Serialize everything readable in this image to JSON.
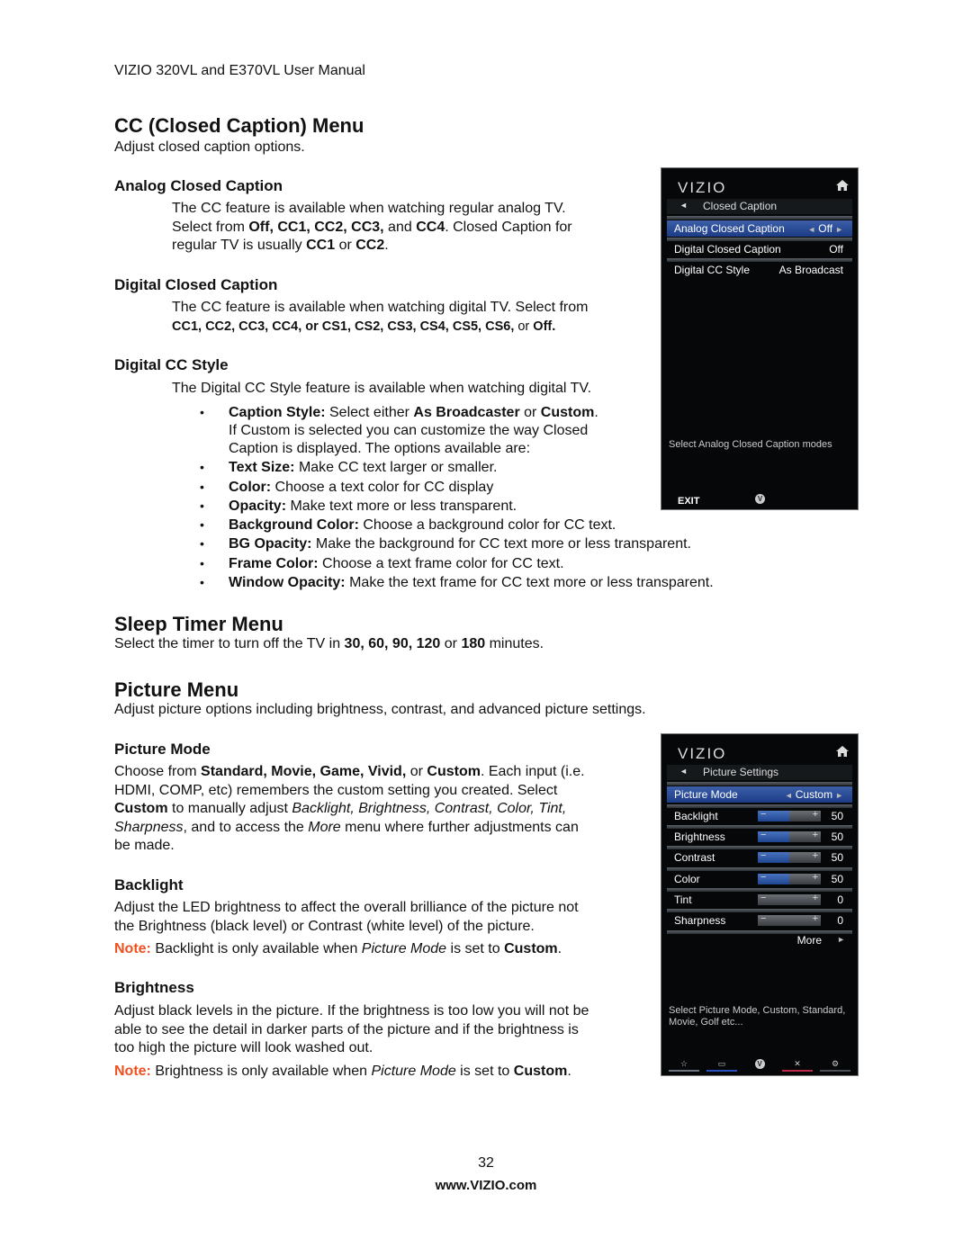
{
  "header": {
    "title": "VIZIO 320VL and E370VL User Manual"
  },
  "cc_section": {
    "title": "CC (Closed Caption) Menu",
    "intro": "Adjust closed caption options.",
    "analog": {
      "heading": "Analog Closed Caption",
      "line1": "The CC feature is available when watching regular analog TV.",
      "line2_pre": "Select from ",
      "line2_bold": "Off, CC1, CC2, CC3,",
      "line2_mid": " and ",
      "line2_bold2": "CC4",
      "line2_post": ". Closed Caption for",
      "line3_pre": "regular TV is usually ",
      "line3_bold": "CC1",
      "line3_mid": " or ",
      "line3_bold2": "CC2",
      "line3_post": "."
    },
    "digital": {
      "heading": "Digital Closed Caption",
      "line1": "The CC feature is available when watching digital TV. Select from",
      "line2_bold": "CC1, CC2, CC3, CC4, or CS1, CS2, CS3, CS4, CS5, CS6,",
      "line2_mid": " or ",
      "line2_bold2": "Off."
    },
    "style": {
      "heading": "Digital CC Style",
      "intro": "The Digital CC Style feature is available when watching digital TV.",
      "bullets": [
        {
          "term": "Caption Style:",
          "text": " Select either ",
          "b1": "As Broadcaster",
          "mid": " or ",
          "b2": "Custom",
          "end": ".",
          "cont1": "If Custom is selected you can customize the way Closed",
          "cont2": "Caption is displayed. The options available are:"
        },
        {
          "term": "Text Size:",
          "text": " Make CC text larger or smaller."
        },
        {
          "term": "Color:",
          "text": " Choose a text color for CC display"
        },
        {
          "term": "Opacity:",
          "text": " Make text more or less transparent."
        },
        {
          "term": "Background Color:",
          "text": " Choose a background color for CC text."
        },
        {
          "term": "BG Opacity:",
          "text": " Make the background for CC text more or less transparent."
        },
        {
          "term": "Frame Color:",
          "text": " Choose a text frame color for CC text."
        },
        {
          "term": "Window Opacity:",
          "text": " Make the text frame for CC text more or less transparent."
        }
      ]
    }
  },
  "sleep_section": {
    "title": "Sleep Timer Menu",
    "pre": "Select the timer to turn off the TV in ",
    "bold": "30, 60, 90, 120",
    "mid": " or ",
    "bold2": "180",
    "post": " minutes."
  },
  "picture_section": {
    "title": "Picture Menu",
    "intro": "Adjust picture options including brightness, contrast, and advanced picture settings.",
    "mode": {
      "heading": "Picture Mode",
      "l1_pre": "Choose from ",
      "l1_bold": "Standard, Movie, Game, Vivid,",
      "l1_mid": " or ",
      "l1_bold2": "Custom",
      "l1_post": ". Each input (i.e.",
      "l2": "HDMI, COMP, etc) remembers the custom setting you created. Select",
      "l3_bold": "Custom",
      "l3_mid": " to manually adjust ",
      "l3_it": "Backlight, Brightness, Contrast, Color, Tint,",
      "l4_it": "Sharpness",
      "l4_mid": ", and to access the ",
      "l4_it2": "More",
      "l4_post": " menu where further adjustments can",
      "l5": "be made."
    },
    "backlight": {
      "heading": "Backlight",
      "l1": "Adjust the LED brightness to affect the overall brilliance of the picture not",
      "l2": "the Brightness (black level) or Contrast (white level) of the picture.",
      "note_label": "Note:",
      "note_pre": " Backlight is only available when ",
      "note_it": "Picture Mode",
      "note_mid": " is set to ",
      "note_bold": "Custom",
      "note_post": "."
    },
    "brightness": {
      "heading": "Brightness",
      "l1": "Adjust black levels in the picture. If the brightness is too low you will not be",
      "l2": "able to see the detail in darker parts of the picture and if the brightness is",
      "l3": "too high the picture will look washed out.",
      "note_label": "Note:",
      "note_pre": " Brightness is only available when ",
      "note_it": "Picture Mode",
      "note_mid": " is set to ",
      "note_bold": "Custom",
      "note_post": "."
    }
  },
  "cc_screen": {
    "logo": "VIZIO",
    "home_icon": "home-icon",
    "back_icon": "◄",
    "menu_title": "Closed Caption",
    "rows": [
      {
        "label": "Analog Closed Caption",
        "value": "Off",
        "selected": true
      },
      {
        "label": "Digital Closed Caption",
        "value": "Off",
        "selected": false
      },
      {
        "label": "Digital CC Style",
        "value": "As Broadcast",
        "selected": false
      }
    ],
    "hint": "Select Analog Closed Caption modes",
    "exit_label": "EXIT",
    "v_button": "V"
  },
  "picture_screen": {
    "logo": "VIZIO",
    "back_icon": "◄",
    "menu_title": "Picture Settings",
    "mode_row": {
      "label": "Picture Mode",
      "value": "Custom"
    },
    "sliders": [
      {
        "label": "Backlight",
        "value": "50",
        "level": 0.5
      },
      {
        "label": "Brightness",
        "value": "50",
        "level": 0.5
      },
      {
        "label": "Contrast",
        "value": "50",
        "level": 0.5
      },
      {
        "label": "Color",
        "value": "50",
        "level": 0.5
      },
      {
        "label": "Tint",
        "value": "0",
        "level": 0
      },
      {
        "label": "Sharpness",
        "value": "0",
        "level": 0
      }
    ],
    "more_label": "More",
    "hint_line1": "Select Picture Mode, Custom, Standard,",
    "hint_line2": "Movie, Golf etc...",
    "nav": [
      {
        "icon": "☆",
        "name": "star-icon",
        "color": "#6b7580"
      },
      {
        "icon": "▭",
        "name": "screen-icon",
        "color": "#2a4fc0"
      },
      {
        "icon": "V",
        "name": "vizio-v-icon",
        "color": ""
      },
      {
        "icon": "✕",
        "name": "close-icon",
        "color": "#c0284a"
      },
      {
        "icon": "⚙",
        "name": "gear-icon",
        "color": "#4a5055"
      }
    ]
  },
  "footer": {
    "page_number": "32",
    "url": "www.VIZIO.com"
  }
}
